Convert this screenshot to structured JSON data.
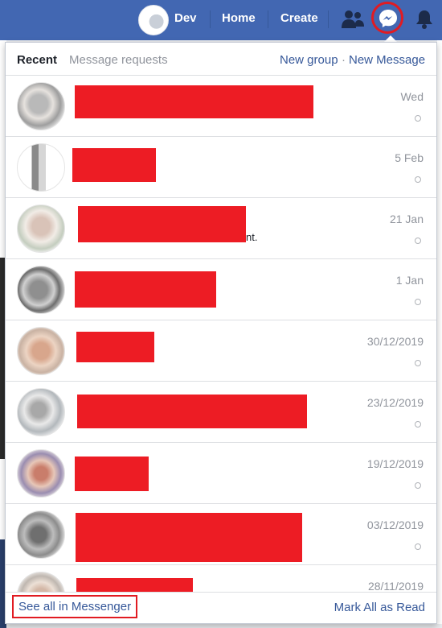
{
  "topbar": {
    "profile_name": "Dev",
    "home_label": "Home",
    "create_label": "Create",
    "icons": [
      "friends-icon",
      "messenger-icon",
      "notifications-icon"
    ]
  },
  "panel": {
    "tabs": {
      "recent": "Recent",
      "requests": "Message requests"
    },
    "new_group": "New group",
    "separator": "·",
    "new_message": "New Message"
  },
  "conversations": [
    {
      "date": "Wed"
    },
    {
      "date": "5 Feb"
    },
    {
      "date": "21 Jan",
      "snippet_end": "nt."
    },
    {
      "date": "1 Jan"
    },
    {
      "date": "30/12/2019"
    },
    {
      "date": "23/12/2019"
    },
    {
      "date": "19/12/2019"
    },
    {
      "date": "03/12/2019"
    },
    {
      "date": "28/11/2019"
    }
  ],
  "footer": {
    "see_all": "See all in Messenger",
    "mark_all_read": "Mark All as Read"
  },
  "colors": {
    "topbar": "#4267b2",
    "link": "#365899",
    "redaction": "#ed1c24",
    "highlight": "#e11b22"
  }
}
